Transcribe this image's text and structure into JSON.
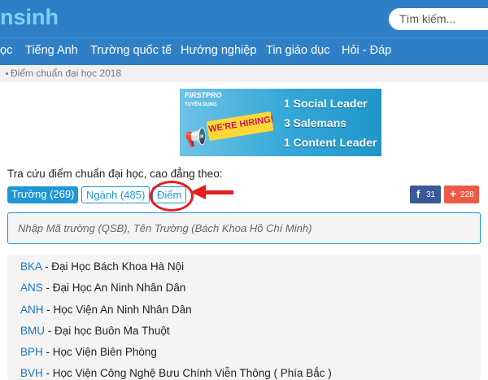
{
  "header": {
    "logo_text": "nsinh",
    "search_placeholder": "Tìm kiếm..."
  },
  "nav": {
    "items": [
      {
        "label": "ọc"
      },
      {
        "label": "Tiếng Anh"
      },
      {
        "label": "Trường quốc tế"
      },
      {
        "label": "Hướng nghiệp"
      },
      {
        "label": "Tin giáo dục"
      },
      {
        "label": "Hỏi - Đáp"
      }
    ]
  },
  "breadcrumb": {
    "text": "Điểm chuẩn đại học 2018"
  },
  "banner": {
    "brand": "FIRSTPRO",
    "subtitle": "TUYỂN DỤNG",
    "badge": "WE'RE HIRING!",
    "lines": [
      "1 Social Leader",
      "3 Salemans",
      "1 Content Leader"
    ]
  },
  "lookup": {
    "label": "Tra cứu điểm chuẩn đại học, cao đẳng theo:",
    "tabs": [
      {
        "label": "Trường (269)"
      },
      {
        "label": "Ngành (485)"
      },
      {
        "label": "Điểm"
      }
    ],
    "search_placeholder": "Nhập Mã trường (QSB), Tên Trường (Bách Khoa Hồ Chí Minh)"
  },
  "share": {
    "facebook_count": "31",
    "plus_count": "228"
  },
  "schools": [
    {
      "code": "BKA",
      "name": " - Đại Học Bách Khoa Hà Nội"
    },
    {
      "code": "ANS",
      "name": " - Đại Học An Ninh Nhân Dân"
    },
    {
      "code": "ANH",
      "name": " - Học Viện An Ninh Nhân Dân"
    },
    {
      "code": "BMU",
      "name": " - Đại học Buôn Ma Thuột"
    },
    {
      "code": "BPH",
      "name": " - Học Viện Biên Phòng"
    },
    {
      "code": "BVH",
      "name": " - Học Viện Công Nghệ Bưu Chính Viễn Thông ( Phía Bắc )"
    }
  ],
  "colors": {
    "header_blue": "#2f7fc7",
    "accent_blue": "#1e97d6",
    "annotation_red": "#e41e1e",
    "facebook": "#3b5998",
    "plus": "#ef5a47"
  }
}
